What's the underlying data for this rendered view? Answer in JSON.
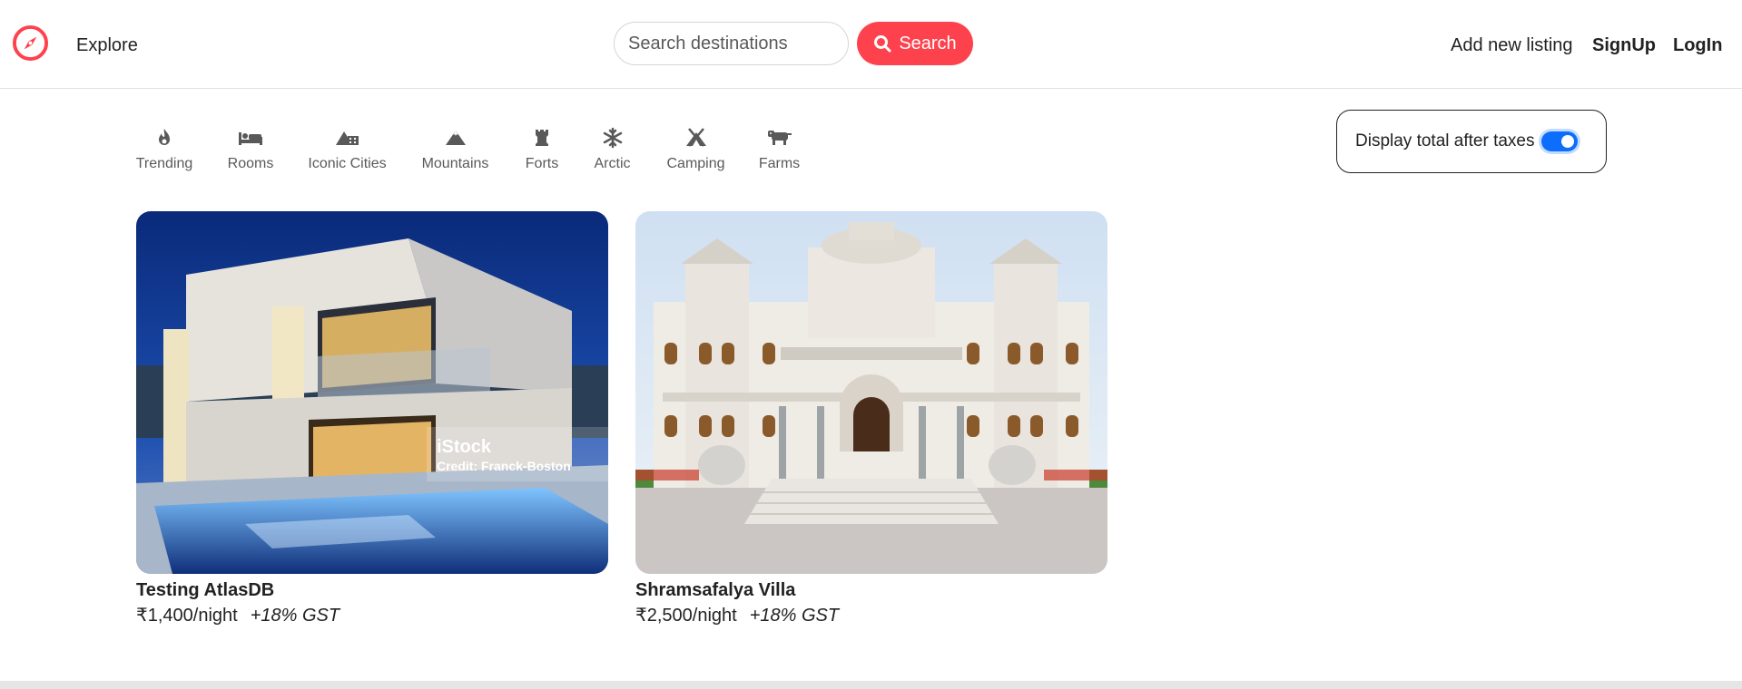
{
  "colors": {
    "brand": "#fe424d",
    "toggle_on": "#0d6efd",
    "text": "#222222"
  },
  "navbar": {
    "logo_icon": "compass-icon",
    "explore_label": "Explore",
    "search": {
      "placeholder": "Search destinations",
      "value": "",
      "button_label": "Search",
      "button_icon": "search-icon"
    },
    "add_listing_label": "Add new listing",
    "signup_label": "SignUp",
    "login_label": "LogIn"
  },
  "filters": [
    {
      "label": "Trending",
      "icon": "fire-icon"
    },
    {
      "label": "Rooms",
      "icon": "bed-icon"
    },
    {
      "label": "Iconic Cities",
      "icon": "city-mountain-icon"
    },
    {
      "label": "Mountains",
      "icon": "mountain-icon"
    },
    {
      "label": "Forts",
      "icon": "fort-tower-icon"
    },
    {
      "label": "Arctic",
      "icon": "snowflake-icon"
    },
    {
      "label": "Camping",
      "icon": "campground-icon"
    },
    {
      "label": "Farms",
      "icon": "cow-icon"
    }
  ],
  "tax_toggle": {
    "label": "Display total after taxes",
    "enabled": true
  },
  "listings": [
    {
      "title": "Testing AtlasDB",
      "price": "₹1,400/night",
      "tax": "+18% GST",
      "image_caption": "iStock",
      "image_credit": "Credit: Franck-Boston"
    },
    {
      "title": "Shramsafalya Villa",
      "price": "₹2,500/night",
      "tax": "+18% GST"
    }
  ]
}
